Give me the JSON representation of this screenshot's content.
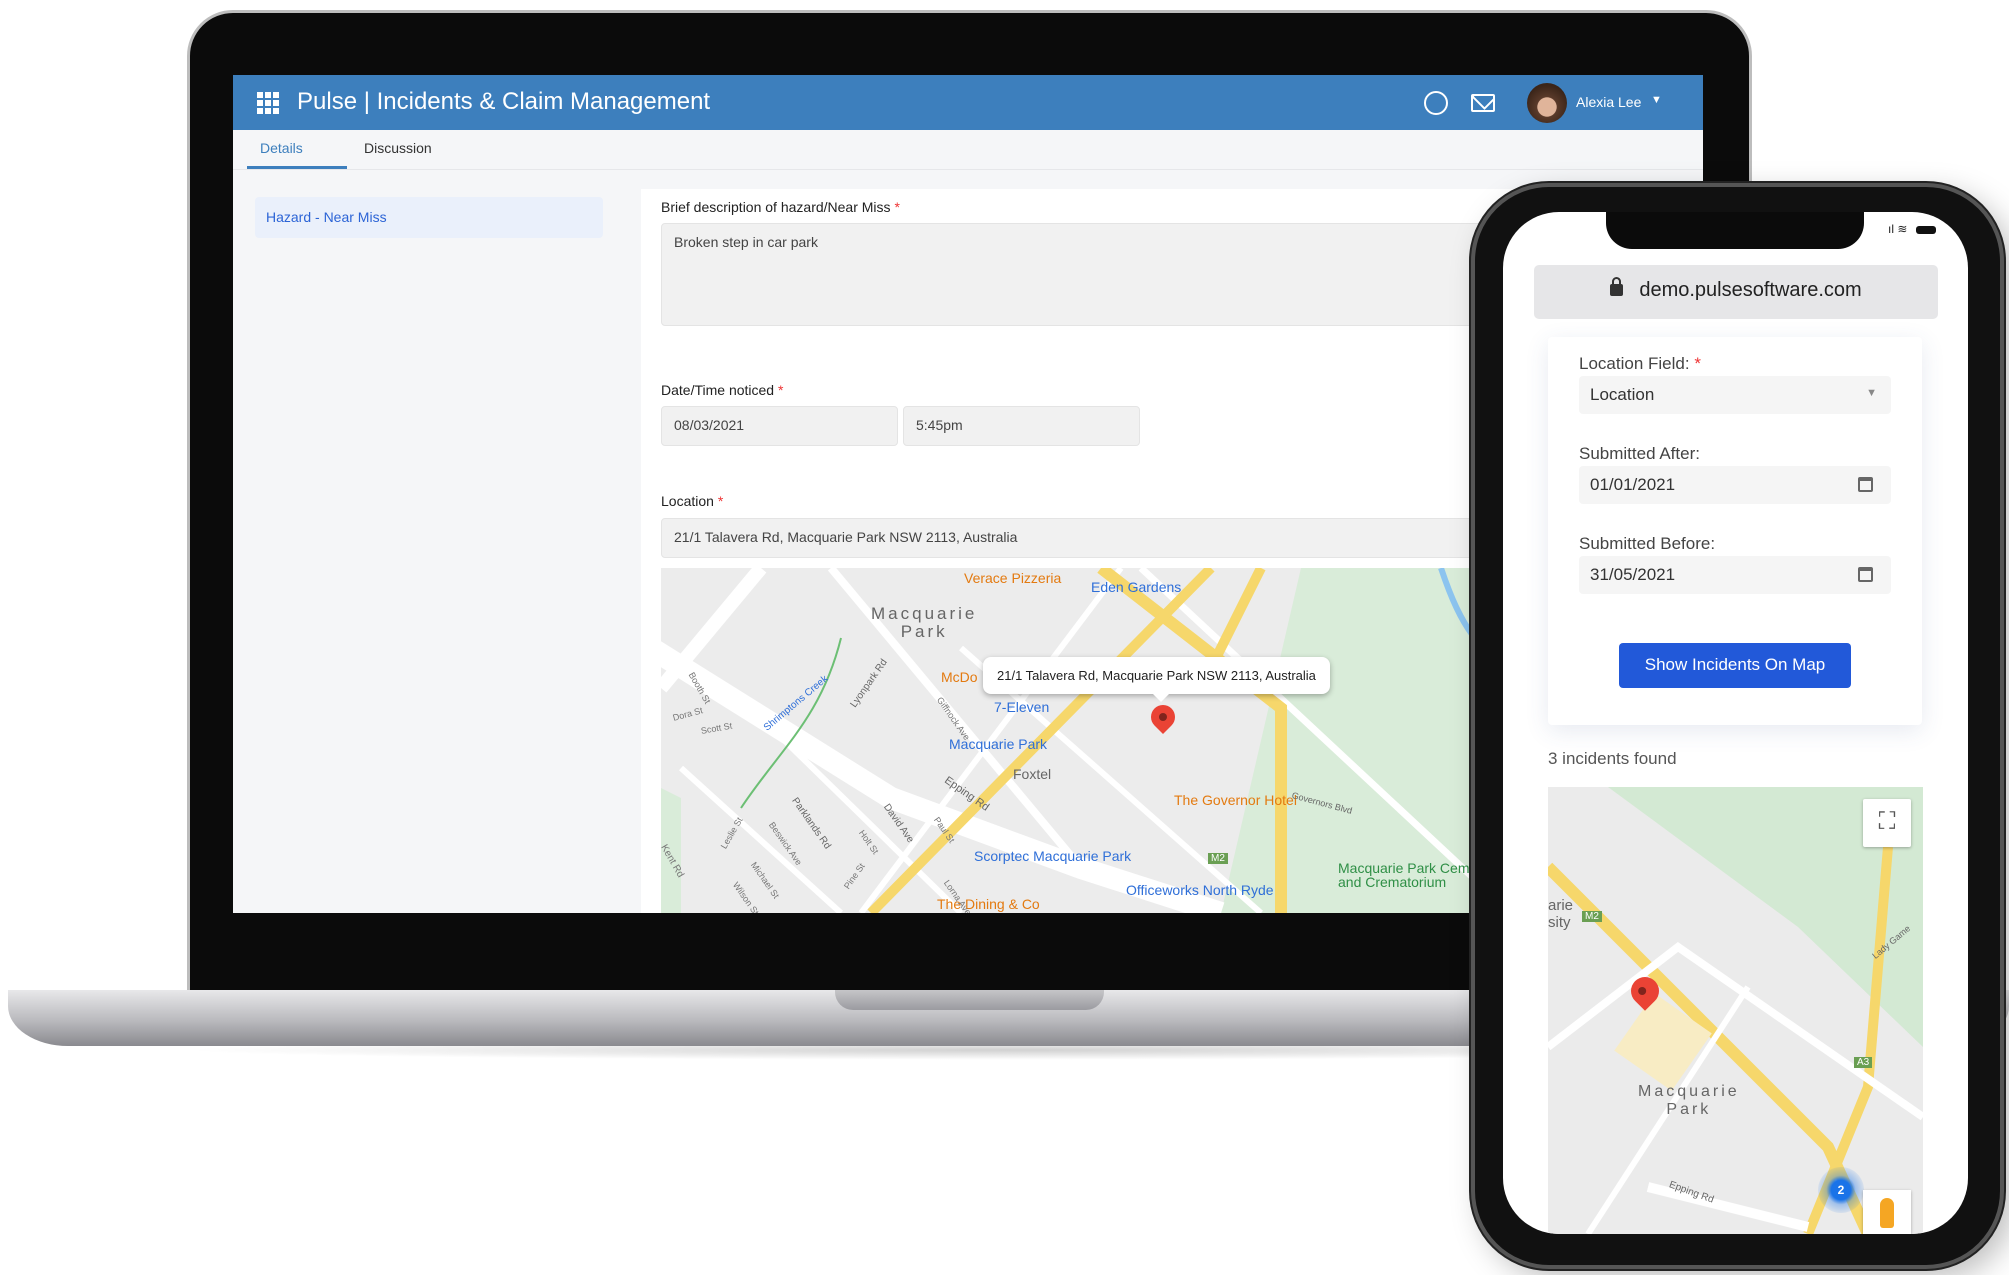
{
  "app": {
    "title": "Pulse | Incidents & Claim Management",
    "user_name": "Alexia Lee"
  },
  "icons": {
    "apps": "grid-icon",
    "globe": "globe-icon",
    "mail": "mail-icon",
    "user_menu": "chevron-down-icon",
    "lock": "lock-icon",
    "calendar": "calendar-icon",
    "fullscreen": "fullscreen-icon",
    "pegman": "street-view-icon"
  },
  "tabs": [
    {
      "label": "Details",
      "active": true
    },
    {
      "label": "Discussion",
      "active": false
    }
  ],
  "sidebar": {
    "items": [
      {
        "label": "Hazard - Near Miss",
        "active": true
      }
    ]
  },
  "form": {
    "description": {
      "label": "Brief description of hazard/Near Miss",
      "required": "*",
      "value": "Broken step in car park"
    },
    "datetime": {
      "label": "Date/Time noticed",
      "required": "*",
      "date": "08/03/2021",
      "time": "5:45pm"
    },
    "location": {
      "label": "Location",
      "required": "*",
      "value": "21/1 Talavera Rd, Macquarie Park NSW 2113, Australia"
    }
  },
  "map": {
    "tooltip": "21/1 Talavera Rd, Macquarie Park NSW 2113, Australia",
    "area_label": "Macquarie\nPark",
    "places": [
      {
        "name": "Verace Pizzeria",
        "kind": "orange"
      },
      {
        "name": "Eden Gardens",
        "kind": "blue"
      },
      {
        "name": "McDo",
        "kind": "orange"
      },
      {
        "name": "7-Eleven",
        "kind": "blue"
      },
      {
        "name": "Macquarie Park",
        "kind": "blue"
      },
      {
        "name": "Foxtel",
        "kind": "grey"
      },
      {
        "name": "The Governor Hotel",
        "kind": "orange"
      },
      {
        "name": "Scorptec Macquarie Park",
        "kind": "blue"
      },
      {
        "name": "Officeworks North Ryde",
        "kind": "blue"
      },
      {
        "name": "Macquarie Park Cem",
        "kind": "green"
      },
      {
        "name": "and Crematorium",
        "kind": "green"
      },
      {
        "name": "The Dining & Co",
        "kind": "orange"
      }
    ],
    "streets": [
      "Epping Rd",
      "Lyonpark Rd",
      "Shrimptons Creek",
      "Booth St",
      "Dora St",
      "Scott St",
      "Parklands Rd",
      "Beswick Ave",
      "David Ave",
      "Holt St",
      "Paul St",
      "Giffnock Ave",
      "Kent Rd",
      "Leslie St",
      "Michael St",
      "Wilson St",
      "Pine St",
      "Lorna Ave",
      "Governors Blvd"
    ],
    "road_badge": "M2",
    "colors": {
      "marker": "#ea4335",
      "highway": "#f6d76b",
      "park": "#cfe7cf"
    }
  },
  "phone": {
    "url": "demo.pulsesoftware.com",
    "location_field": {
      "label": "Location Field:",
      "required": "*",
      "value": "Location"
    },
    "submitted_after": {
      "label": "Submitted After:",
      "value": "01/01/2021"
    },
    "submitted_before": {
      "label": "Submitted Before:",
      "value": "31/05/2021"
    },
    "button": "Show Incidents On Map",
    "result_text": "3 incidents found",
    "map": {
      "cluster_count": "2",
      "area_label": "Macquarie\nPark",
      "labels": [
        "arie",
        "sity",
        "Epping Rd",
        "Lady Game"
      ],
      "badges": [
        "M2",
        "A3"
      ]
    }
  },
  "colors": {
    "header": "#3d7fbd",
    "primary_button": "#2259d9",
    "required": "#ee3333"
  }
}
